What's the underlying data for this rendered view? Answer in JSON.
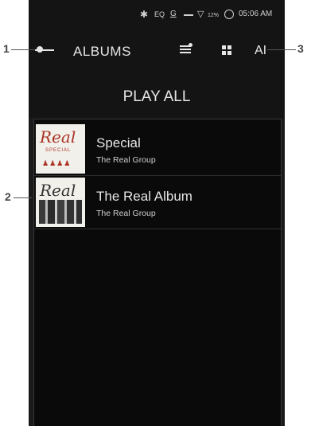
{
  "status_bar": {
    "bluetooth_icon": "bluetooth-icon",
    "eq_label": "EQ",
    "gain_label": "G",
    "battery_percent": "12%",
    "time": "05:06 AM"
  },
  "header": {
    "title": "ALBUMS",
    "sort_label": "AI"
  },
  "play_all_label": "PLAY ALL",
  "albums": [
    {
      "title": "Special",
      "artist": "The Real Group",
      "cover_script": "Real",
      "cover_subtitle": "SPECIAL"
    },
    {
      "title": "The Real Album",
      "artist": "The Real Group",
      "cover_script": "Real"
    }
  ],
  "callouts": [
    "1",
    "2",
    "3"
  ],
  "colors": {
    "background": "#191919",
    "header": "#141414",
    "text": "#e6e6e6",
    "cover_red": "#a93225"
  }
}
